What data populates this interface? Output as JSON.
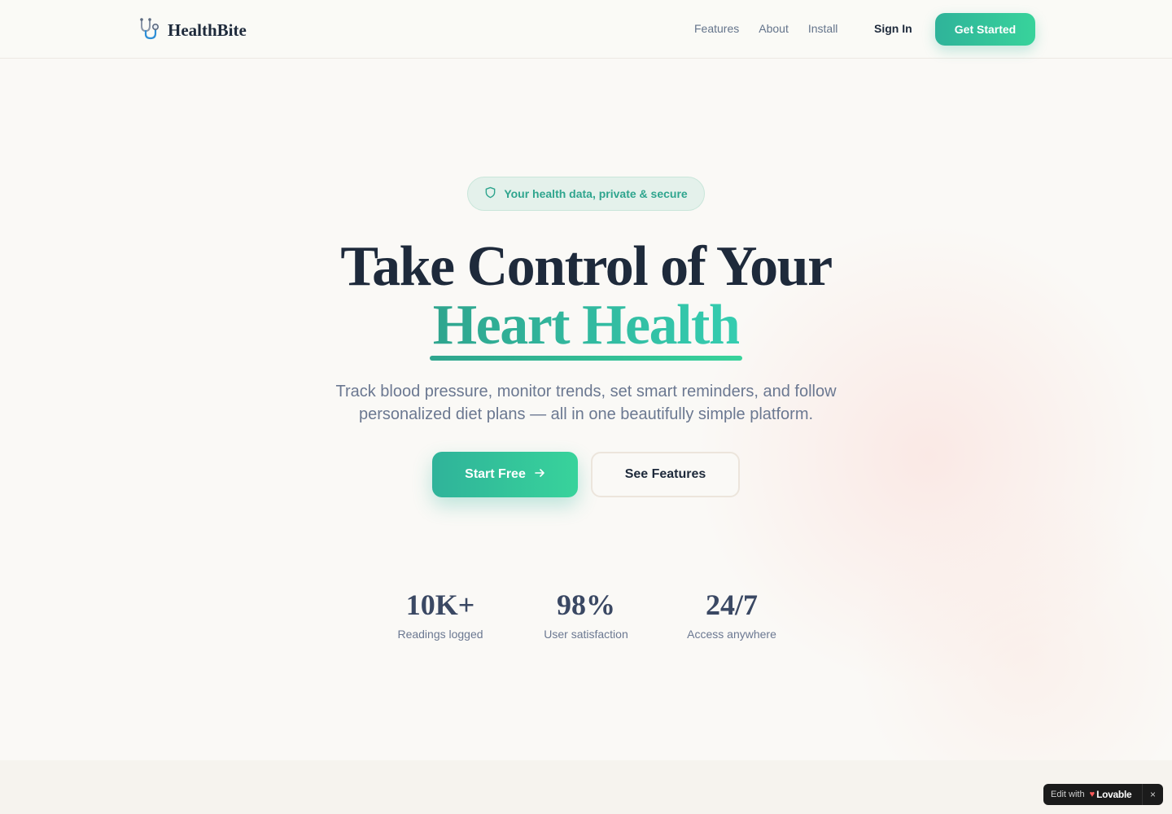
{
  "header": {
    "brand_name": "HealthBite",
    "brand_icon": "stethoscope-icon",
    "nav": [
      {
        "label": "Features"
      },
      {
        "label": "About"
      },
      {
        "label": "Install"
      }
    ],
    "sign_in_label": "Sign In",
    "get_started_label": "Get Started"
  },
  "hero": {
    "badge_text": "Your health data, private & secure",
    "badge_icon": "shield-icon",
    "title_line1": "Take Control of Your",
    "title_line2": "Heart Health",
    "subtitle": "Track blood pressure, monitor trends, set smart reminders, and follow personalized diet plans — all in one beautifully simple platform.",
    "primary_cta": "Start Free",
    "secondary_cta": "See Features"
  },
  "stats": [
    {
      "value": "10K+",
      "label": "Readings logged"
    },
    {
      "value": "98%",
      "label": "User satisfaction"
    },
    {
      "value": "24/7",
      "label": "Access anywhere"
    }
  ],
  "badge_widget": {
    "edit_text": "Edit with",
    "brand": "Lovable",
    "close": "×"
  },
  "colors": {
    "accent": "#2fb39a",
    "accent_light": "#38d39b",
    "text_dark": "#1e2a3b",
    "text_muted": "#6b7891",
    "background": "#faf9f6"
  }
}
